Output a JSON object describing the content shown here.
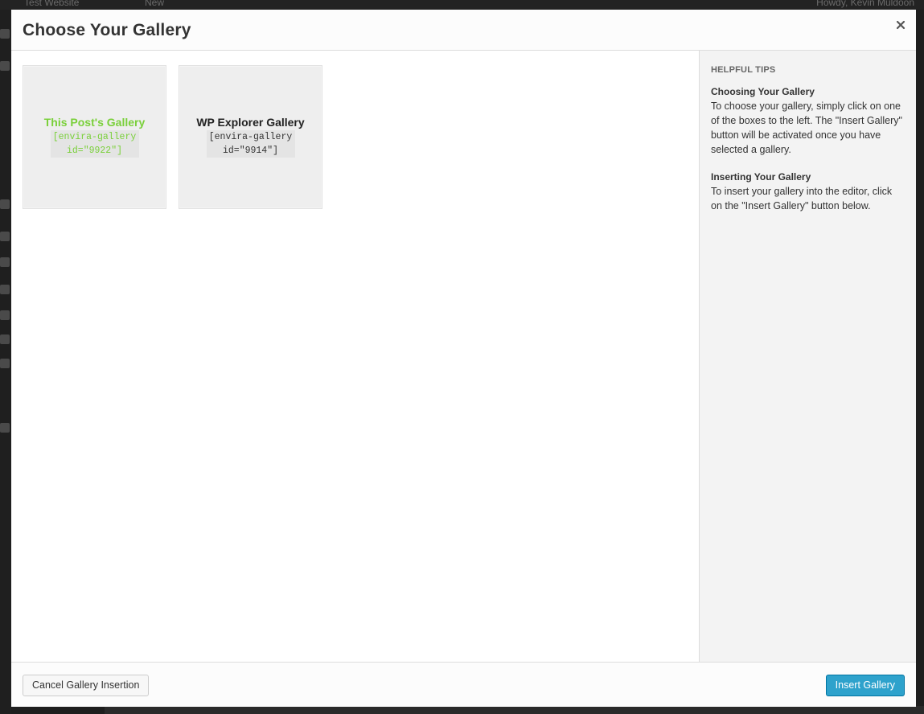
{
  "background": {
    "site_name": "Test Website",
    "new_label": "New",
    "howdy": "Howdy, Kevin Muldoon"
  },
  "modal": {
    "title": "Choose Your Gallery",
    "close_icon": "close-icon"
  },
  "galleries": [
    {
      "name": "This Post's Gallery",
      "shortcode": "[envira-gallery id=\"9922\"]",
      "selected": true
    },
    {
      "name": "WP Explorer Gallery",
      "shortcode": "[envira-gallery id=\"9914\"]",
      "selected": false
    }
  ],
  "sidebar": {
    "heading": "HELPFUL TIPS",
    "tips": [
      {
        "title": "Choosing Your Gallery",
        "text": "To choose your gallery, simply click on one of the boxes to the left. The \"Insert Gallery\" button will be activated once you have selected a gallery."
      },
      {
        "title": "Inserting Your Gallery",
        "text": "To insert your gallery into the editor, click on the \"Insert Gallery\" button below."
      }
    ]
  },
  "footer": {
    "cancel_label": "Cancel Gallery Insertion",
    "insert_label": "Insert Gallery"
  },
  "colors": {
    "accent_green": "#7ad03a",
    "primary_button": "#2ea2cc"
  }
}
